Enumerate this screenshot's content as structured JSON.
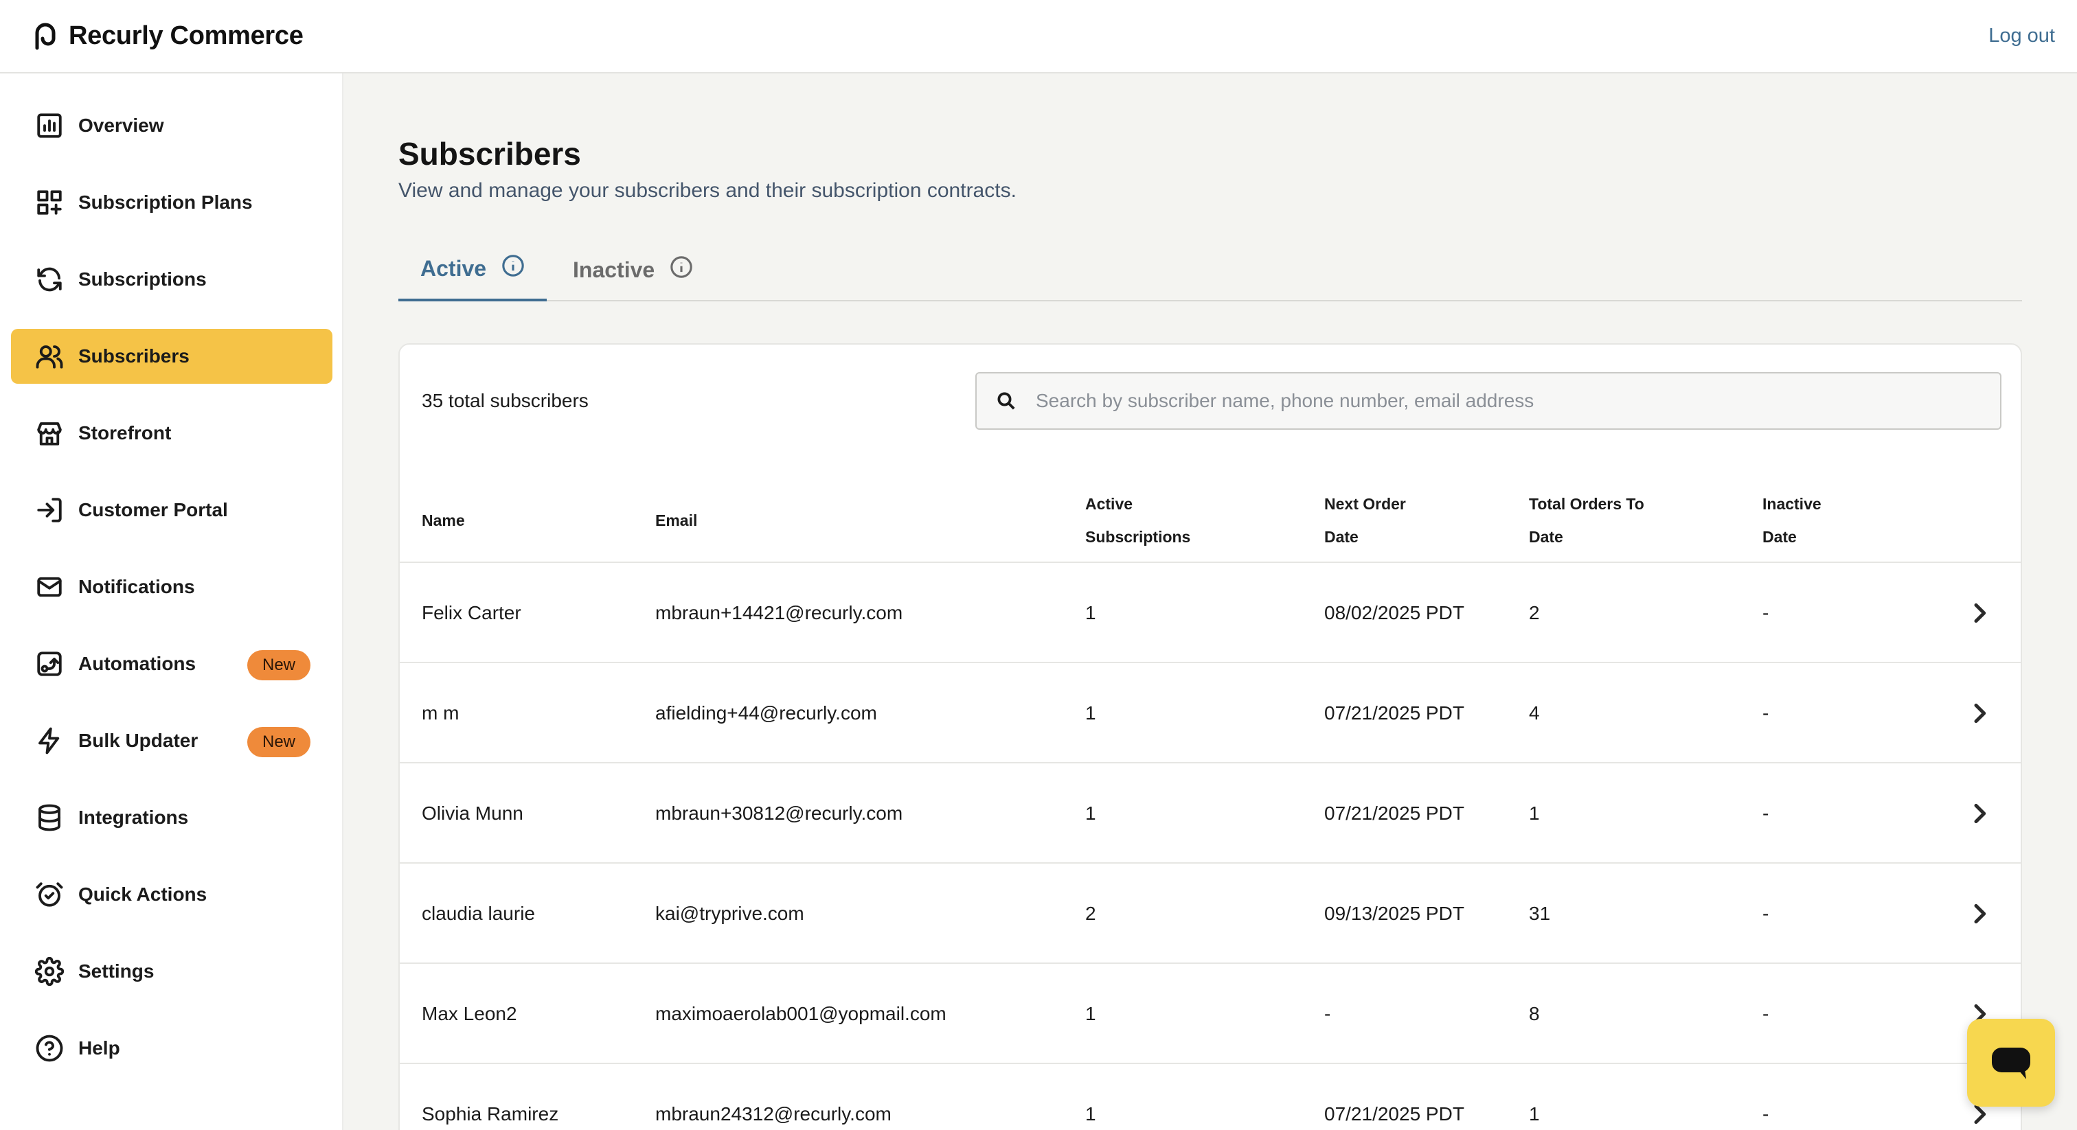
{
  "header": {
    "brand_name": "Recurly Commerce",
    "logout_label": "Log out"
  },
  "sidebar": {
    "items": [
      {
        "label": "Overview",
        "icon": "chart-icon"
      },
      {
        "label": "Subscription Plans",
        "icon": "grid-plus-icon"
      },
      {
        "label": "Subscriptions",
        "icon": "refresh-icon"
      },
      {
        "label": "Subscribers",
        "icon": "users-icon",
        "active": true
      },
      {
        "label": "Storefront",
        "icon": "store-icon"
      },
      {
        "label": "Customer Portal",
        "icon": "login-icon"
      },
      {
        "label": "Notifications",
        "icon": "mail-icon"
      },
      {
        "label": "Automations",
        "icon": "automation-icon",
        "badge": "New"
      },
      {
        "label": "Bulk Updater",
        "icon": "bolt-icon",
        "badge": "New"
      },
      {
        "label": "Integrations",
        "icon": "database-icon"
      },
      {
        "label": "Quick Actions",
        "icon": "alarm-check-icon"
      },
      {
        "label": "Settings",
        "icon": "gear-icon"
      },
      {
        "label": "Help",
        "icon": "help-icon"
      }
    ]
  },
  "page": {
    "title": "Subscribers",
    "subtitle": "View and manage your subscribers and their subscription contracts."
  },
  "tabs": [
    {
      "label": "Active",
      "active": true
    },
    {
      "label": "Inactive",
      "active": false
    }
  ],
  "table": {
    "count_label": "35 total subscribers",
    "search_placeholder": "Search by subscriber name, phone number, email address",
    "search_value": "",
    "headers": {
      "name": "Name",
      "email": "Email",
      "active_subs_1": "Active",
      "active_subs_2": "Subscriptions",
      "next_order_1": "Next Order",
      "next_order_2": "Date",
      "total_orders_1": "Total Orders To",
      "total_orders_2": "Date",
      "inactive_1": "Inactive",
      "inactive_2": "Date"
    },
    "rows": [
      {
        "name": "Felix Carter",
        "email": "mbraun+14421@recurly.com",
        "active": "1",
        "next_order": "08/02/2025 PDT",
        "total_orders": "2",
        "inactive": "-"
      },
      {
        "name": "m m",
        "email": "afielding+44@recurly.com",
        "active": "1",
        "next_order": "07/21/2025 PDT",
        "total_orders": "4",
        "inactive": "-"
      },
      {
        "name": "Olivia Munn",
        "email": "mbraun+30812@recurly.com",
        "active": "1",
        "next_order": "07/21/2025 PDT",
        "total_orders": "1",
        "inactive": "-"
      },
      {
        "name": "claudia laurie",
        "email": "kai@tryprive.com",
        "active": "2",
        "next_order": "09/13/2025 PDT",
        "total_orders": "31",
        "inactive": "-"
      },
      {
        "name": "Max Leon2",
        "email": "maximoaerolab001@yopmail.com",
        "active": "1",
        "next_order": "-",
        "total_orders": "8",
        "inactive": "-"
      },
      {
        "name": "Sophia Ramirez",
        "email": "mbraun24312@recurly.com",
        "active": "1",
        "next_order": "07/21/2025 PDT",
        "total_orders": "1",
        "inactive": "-"
      }
    ]
  },
  "colors": {
    "accent": "#3f6d91",
    "active_nav": "#f5c347",
    "badge": "#ef8a3a",
    "chat": "#f7d74f"
  }
}
